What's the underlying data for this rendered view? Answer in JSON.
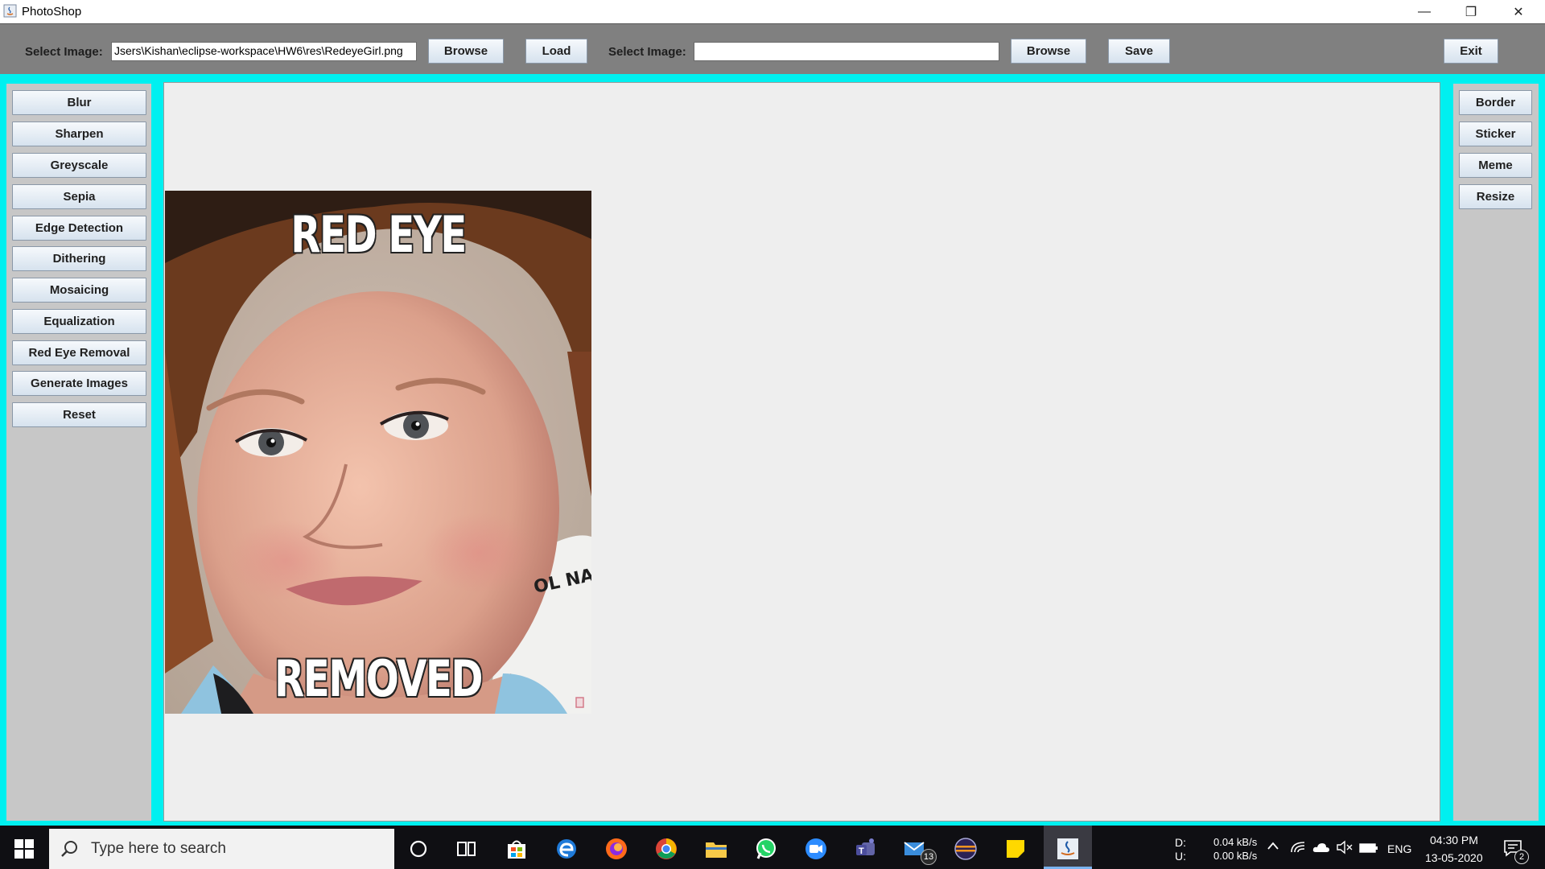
{
  "window": {
    "title": "PhotoShop",
    "minimize_glyph": "—",
    "maximize_glyph": "❐",
    "close_glyph": "✕"
  },
  "toolbar": {
    "select_image_label_1": "Select Image:",
    "path_value_1": "Jsers\\Kishan\\eclipse-workspace\\HW6\\res\\RedeyeGirl.png",
    "browse_1": "Browse",
    "load": "Load",
    "select_image_label_2": "Select Image:",
    "path_value_2": "",
    "browse_2": "Browse",
    "save": "Save",
    "exit": "Exit"
  },
  "left_panel": {
    "buttons": [
      "Blur",
      "Sharpen",
      "Greyscale",
      "Sepia",
      "Edge Detection",
      "Dithering",
      "Mosaicing",
      "Equalization",
      "Red Eye Removal",
      "Generate Images",
      "Reset"
    ]
  },
  "right_panel": {
    "buttons": [
      "Border",
      "Sticker",
      "Meme",
      "Resize"
    ]
  },
  "image": {
    "top_text": "RED EYE",
    "bottom_text": "REMOVED",
    "shirt_text": "OL NA"
  },
  "taskbar": {
    "search_placeholder": "Type here to search",
    "net_down_label": "D:",
    "net_up_label": "U:",
    "net_down": "0.04 kB/s",
    "net_up": "0.00 kB/s",
    "language": "ENG",
    "time": "04:30 PM",
    "date": "13-05-2020",
    "mail_badge": "13",
    "notification_badge": "2",
    "icons": [
      "cortana-icon",
      "task-view-icon",
      "store-icon",
      "edge-icon",
      "firefox-icon",
      "chrome-icon",
      "file-explorer-icon",
      "whatsapp-icon",
      "zoom-icon",
      "teams-icon",
      "mail-icon",
      "eclipse-icon",
      "sticky-notes-icon",
      "java-icon"
    ]
  }
}
